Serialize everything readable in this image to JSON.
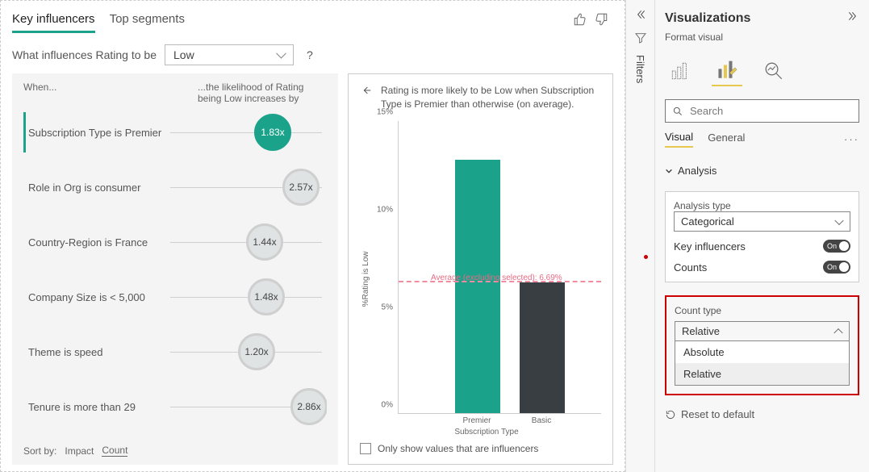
{
  "visual": {
    "tabs": {
      "key_influencers": "Key influencers",
      "top_segments": "Top segments"
    },
    "question_prefix": "What influences Rating to be",
    "question_value": "Low",
    "question_help": "?",
    "headers": {
      "when": "When...",
      "then": "...the likelihood of Rating being Low increases by"
    },
    "influencers": [
      {
        "label": "Subscription Type is Premier",
        "value": "1.83x",
        "pos": 110,
        "selected": true
      },
      {
        "label": "Role in Org is consumer",
        "value": "2.57x",
        "pos": 145
      },
      {
        "label": "Country-Region is France",
        "value": "1.44x",
        "pos": 100
      },
      {
        "label": "Company Size is < 5,000",
        "value": "1.48x",
        "pos": 102
      },
      {
        "label": "Theme is speed",
        "value": "1.20x",
        "pos": 90
      },
      {
        "label": "Tenure is more than 29",
        "value": "2.86x",
        "pos": 155
      }
    ],
    "sort": {
      "label": "Sort by:",
      "impact": "Impact",
      "count": "Count"
    }
  },
  "chart": {
    "title": "Rating is more likely to be Low when Subscription Type is Premier than otherwise (on average).",
    "ylabel": "%Rating is Low",
    "xlabel": "Subscription Type",
    "avg_label": "Average (excluding selected): 6.69%",
    "footer": "Only show values that are influencers"
  },
  "chart_data": {
    "type": "bar",
    "categories": [
      "Premier",
      "Basic"
    ],
    "values": [
      13.0,
      6.69
    ],
    "series_colors": [
      "#1aa38a",
      "#393e42"
    ],
    "ylim": [
      0,
      15
    ],
    "yticks": [
      0,
      5,
      10,
      15
    ],
    "avg_line": 6.69,
    "ylabel": "%Rating is Low",
    "xlabel": "Subscription Type"
  },
  "filters": {
    "label": "Filters"
  },
  "pane": {
    "title": "Visualizations",
    "subtitle": "Format visual",
    "search_placeholder": "Search",
    "tabs": {
      "visual": "Visual",
      "general": "General"
    },
    "section": "Analysis",
    "analysis_type_label": "Analysis type",
    "analysis_type_value": "Categorical",
    "key_influencers_label": "Key influencers",
    "counts_label": "Counts",
    "toggle_on": "On",
    "count_type_label": "Count type",
    "count_type_value": "Relative",
    "count_type_options": {
      "absolute": "Absolute",
      "relative": "Relative"
    },
    "reset": "Reset to default"
  }
}
